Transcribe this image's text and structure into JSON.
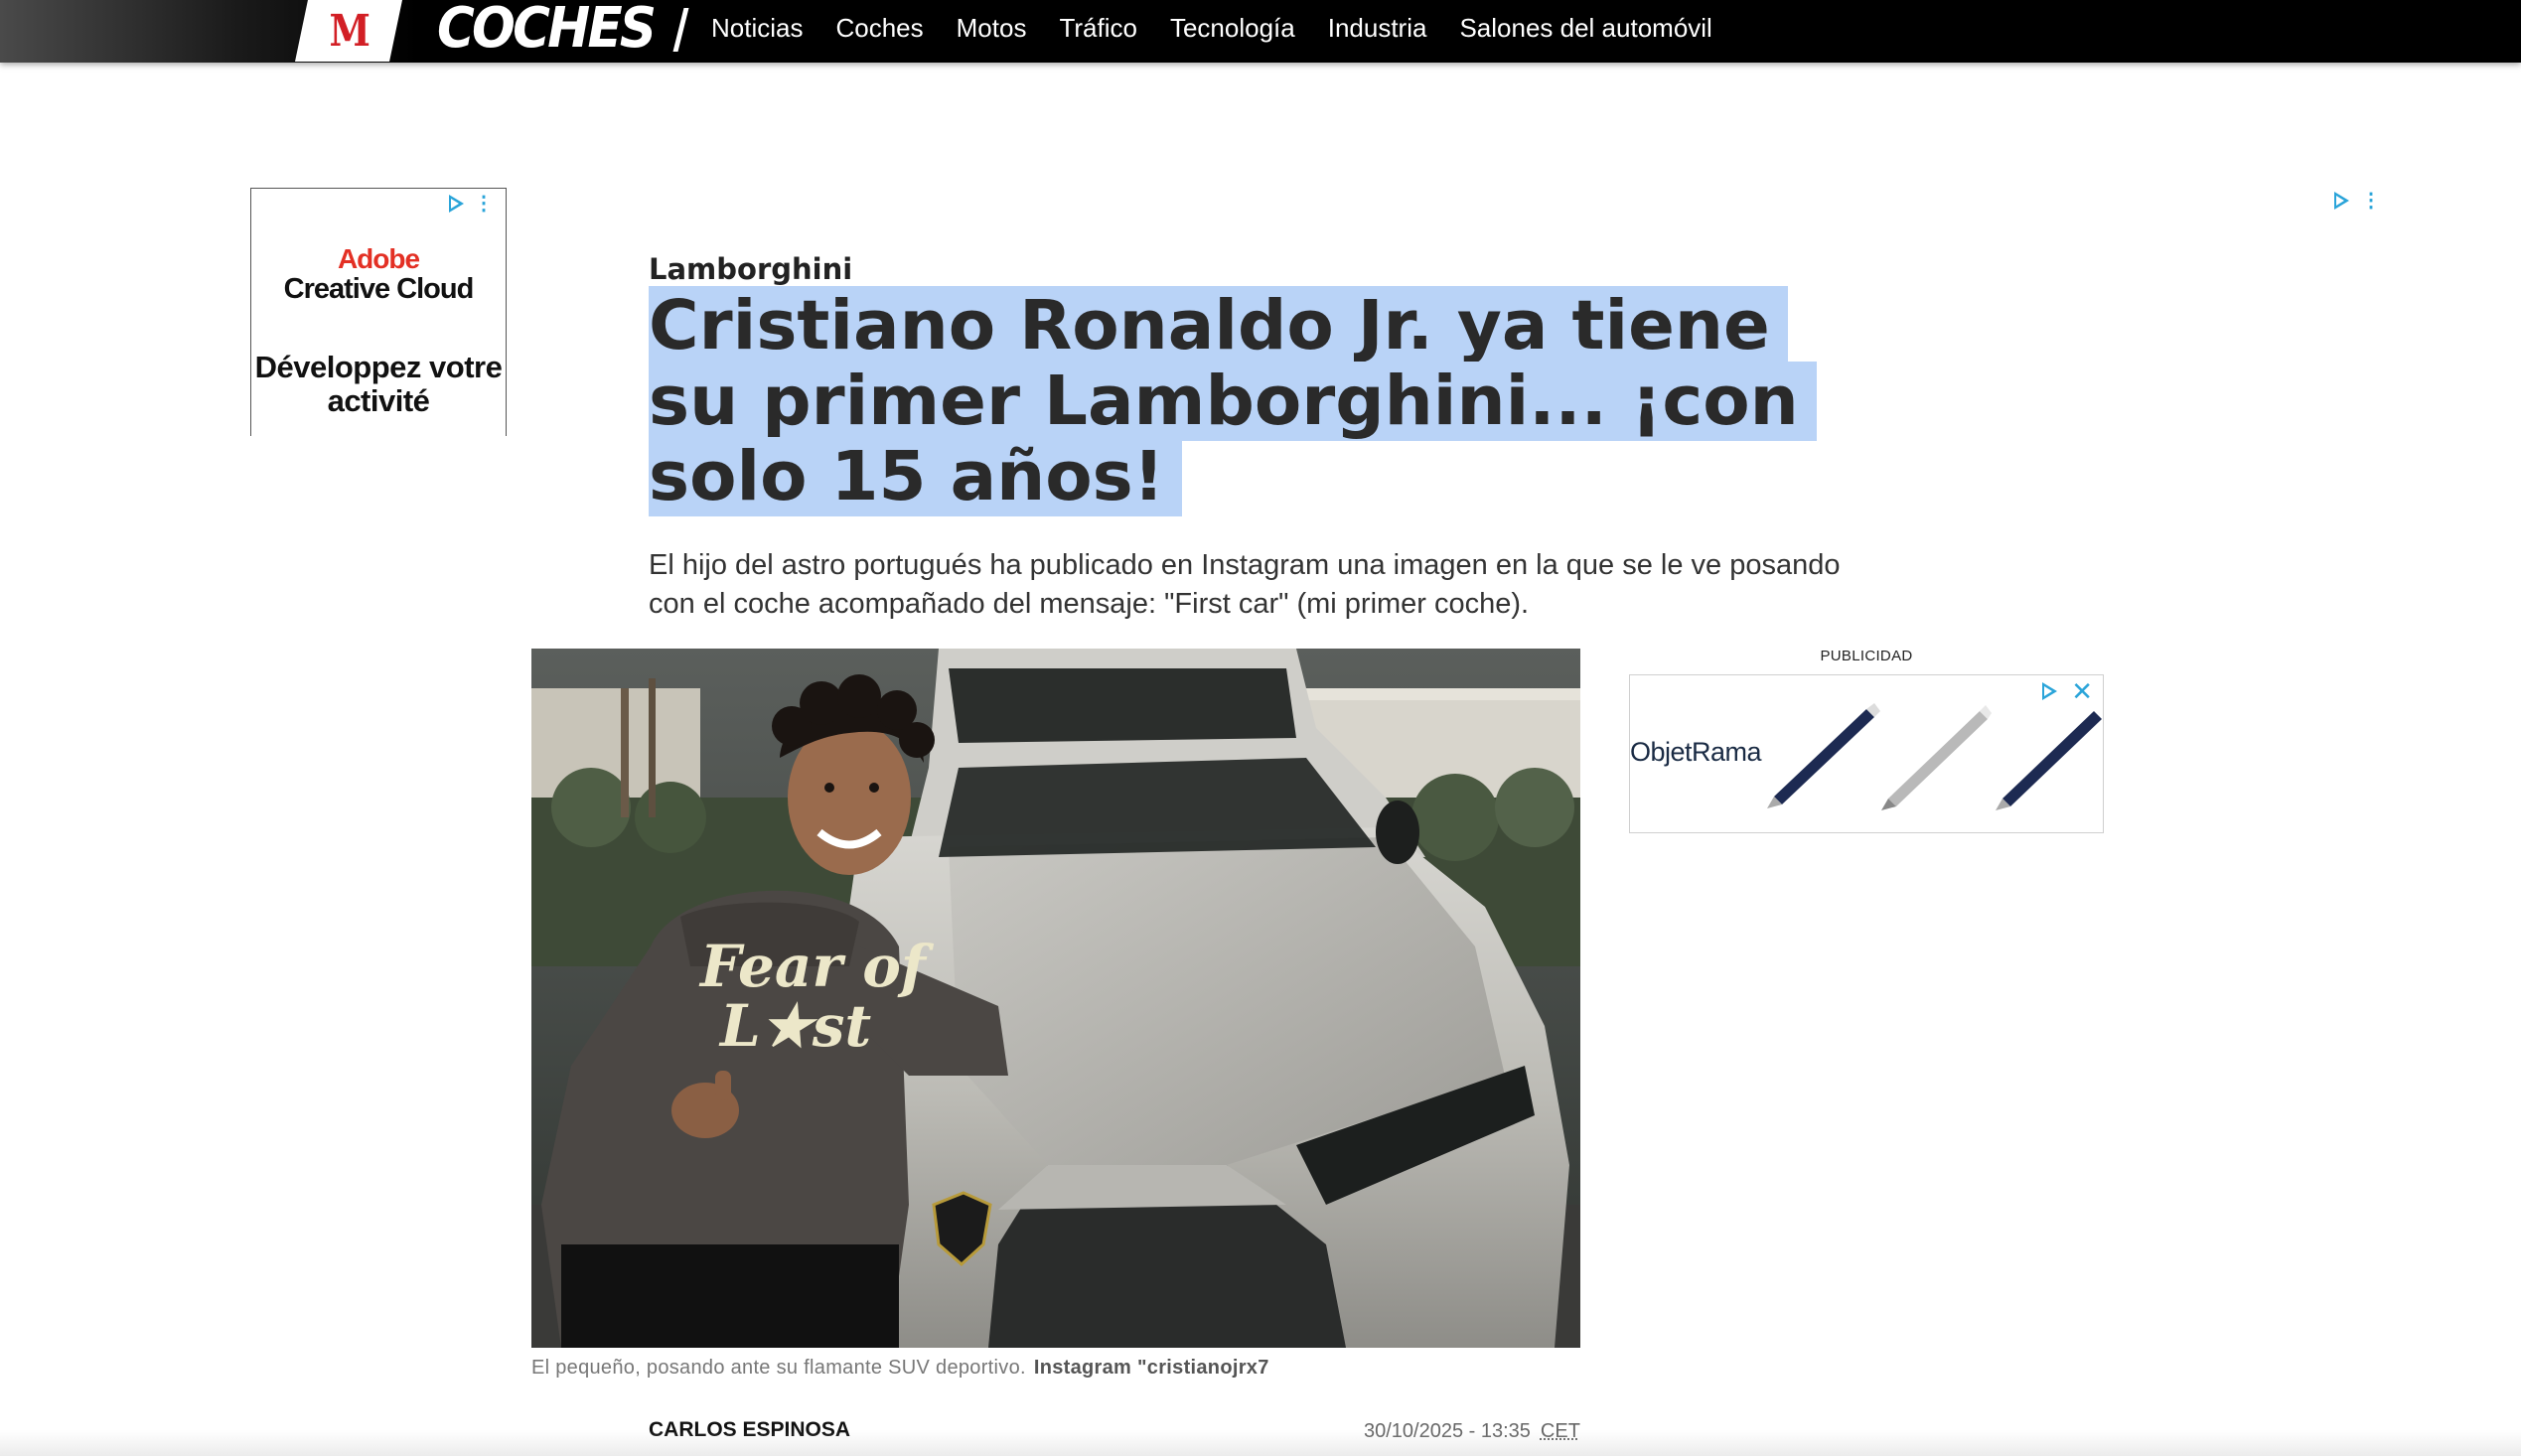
{
  "nav": {
    "logo_letter": "M",
    "logo_text": "COCHES",
    "items": [
      "Noticias",
      "Coches",
      "Motos",
      "Tráfico",
      "Tecnología",
      "Industria",
      "Salones del automóvil"
    ]
  },
  "ad_left": {
    "brand_line1": "Adobe",
    "brand_line2": "Creative Cloud",
    "message": "Développez votre activité"
  },
  "article": {
    "kicker": "Lamborghini",
    "headline": "Cristiano Ronaldo Jr. ya tiene su primer Lamborghini... ¡con solo 15 años!",
    "subhead": "El hijo del astro portugués ha publicado en Instagram una imagen en la que se le ve posando con el coche acompañado del mensaje: \"First car\" (mi primer coche).",
    "photo_caption": "El pequeño, posando ante su flamante SUV deportivo.",
    "photo_credit": "Instagram \"cristianojrx7",
    "hoodie_text": "Fear of Lost",
    "author": "CARLOS ESPINOSA",
    "date": "30/10/2025 - 13:35",
    "timezone": "CET"
  },
  "ad_right": {
    "label": "PUBLICIDAD",
    "brand": "ObjetRama"
  },
  "colors": {
    "selection": "#b9d3f7",
    "brand_red": "#d21f25",
    "adchoice_blue": "#2aa4d9"
  }
}
